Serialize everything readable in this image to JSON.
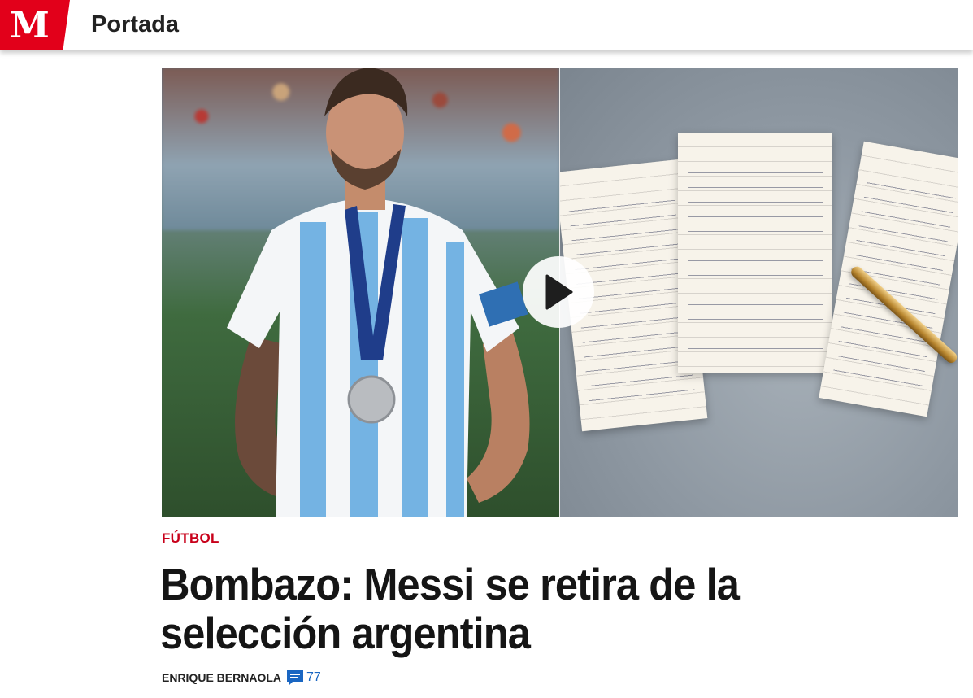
{
  "header": {
    "logo_text": "M",
    "section_title": "Portada",
    "brand_color": "#e2001a"
  },
  "hero": {
    "media_type": "video",
    "play_icon": "play-icon"
  },
  "article": {
    "category": "FÚTBOL",
    "category_color": "#c8001a",
    "headline_line1": "Bombazo: Messi se retira de la",
    "headline_line2": "selección argentina",
    "author": "ENRIQUE BERNAOLA",
    "comment_icon": "comment-icon",
    "comment_count": "77",
    "comment_color": "#1a66c2"
  }
}
